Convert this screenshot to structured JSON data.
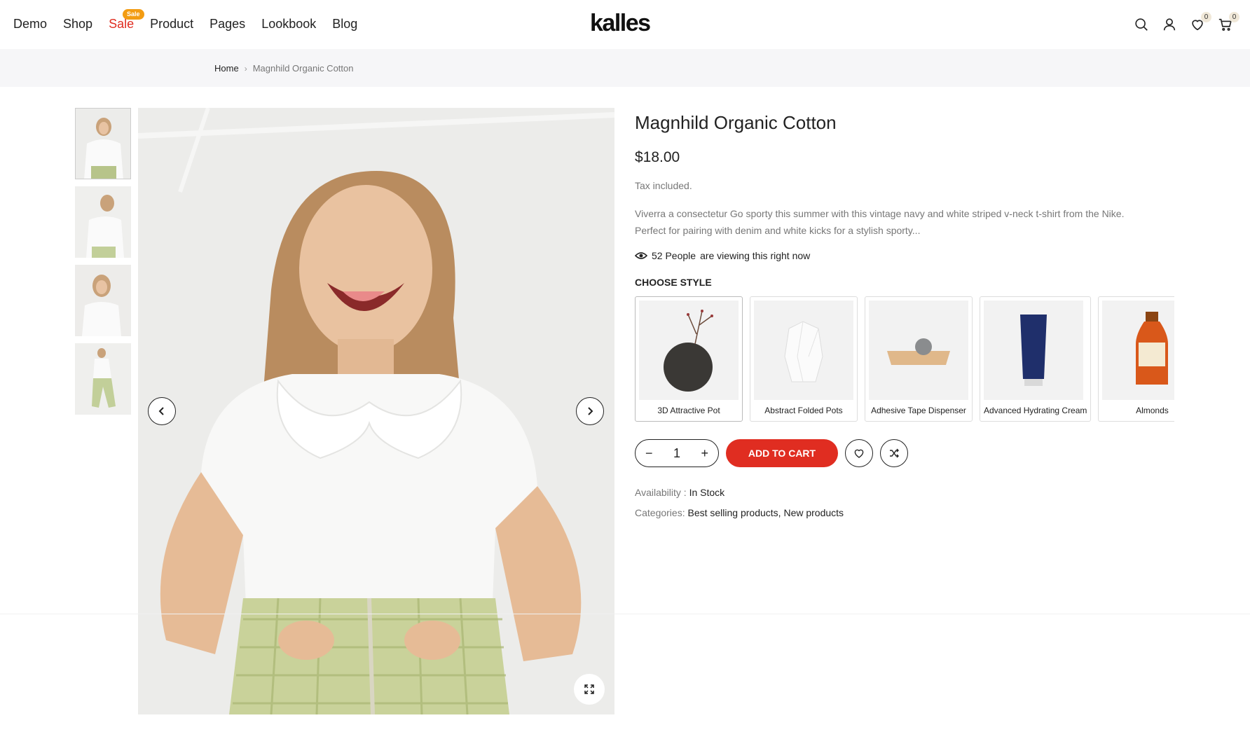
{
  "nav": {
    "items": [
      "Demo",
      "Shop",
      "Sale",
      "Product",
      "Pages",
      "Lookbook",
      "Blog"
    ],
    "sale_badge": "Sale"
  },
  "logo": "kalles",
  "header_icons": {
    "search": "search-icon",
    "account": "user-icon",
    "wishlist_count": "0",
    "cart_count": "0"
  },
  "breadcrumb": {
    "home": "Home",
    "current": "Magnhild Organic Cotton"
  },
  "product": {
    "title": "Magnhild Organic Cotton",
    "price": "$18.00",
    "tax_note": "Tax included.",
    "description": "Viverra a consectetur Go sporty this summer with this vintage navy and white striped v-neck t-shirt from the Nike. Perfect for pairing with denim and white kicks for a stylish sporty...",
    "viewing_count": "52 People",
    "viewing_text": "are viewing this right now",
    "choose_style_label": "CHOOSE STYLE",
    "styles": [
      {
        "name": "3D Attractive Pot"
      },
      {
        "name": "Abstract Folded Pots"
      },
      {
        "name": "Adhesive Tape Dispenser"
      },
      {
        "name": "Advanced Hydrating Cream"
      },
      {
        "name": "Almonds"
      }
    ],
    "quantity": "1",
    "add_to_cart": "ADD TO CART",
    "availability_label": "Availability :",
    "availability_value": "In Stock",
    "categories_label": "Categories:",
    "categories": [
      "Best selling products",
      "New products"
    ],
    "category_separator": ", "
  },
  "colors": {
    "accent_red": "#e02d21",
    "badge_orange": "#f39c12",
    "breadcrumb_bg": "#f6f6f8"
  }
}
